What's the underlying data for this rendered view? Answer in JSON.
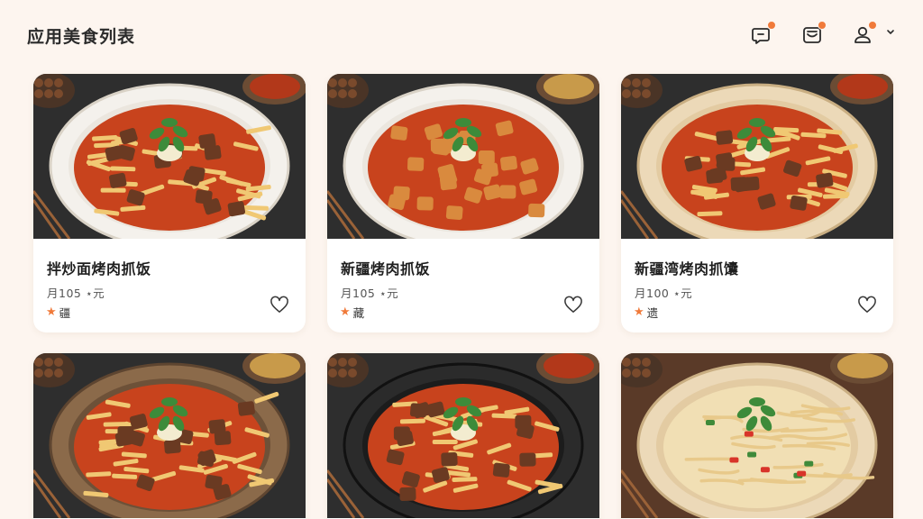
{
  "header": {
    "title": "应用美食列表",
    "icons": [
      "chat-bubble-icon",
      "inbox-icon",
      "user-icon",
      "chevron-down-icon"
    ],
    "badge_color": "#f07a3a"
  },
  "dishes": [
    {
      "name": "拌炒面烤肉抓饭",
      "price": "月105 ⋆元",
      "rating": "疆",
      "plate": "white",
      "dish": "noodle-meat"
    },
    {
      "name": "新疆烤肉抓饭",
      "price": "月105 ⋆元",
      "rating": "藏",
      "plate": "white",
      "dish": "meat-cubes"
    },
    {
      "name": "新疆湾烤肉抓馕",
      "price": "月100 ⋆元",
      "rating": "遗",
      "plate": "flatbread",
      "dish": "noodle-meat"
    },
    {
      "name": "",
      "price": "",
      "rating": "",
      "plate": "brown",
      "dish": "noodle-meat"
    },
    {
      "name": "",
      "price": "",
      "rating": "",
      "plate": "black",
      "dish": "noodle-meat"
    },
    {
      "name": "",
      "price": "",
      "rating": "",
      "plate": "flatbread",
      "dish": "plain-noodles"
    }
  ],
  "colors": {
    "accent": "#f07a3a",
    "background": "#fdf5ef",
    "sauce": "#c8431d",
    "table": "#2e2e2e"
  }
}
